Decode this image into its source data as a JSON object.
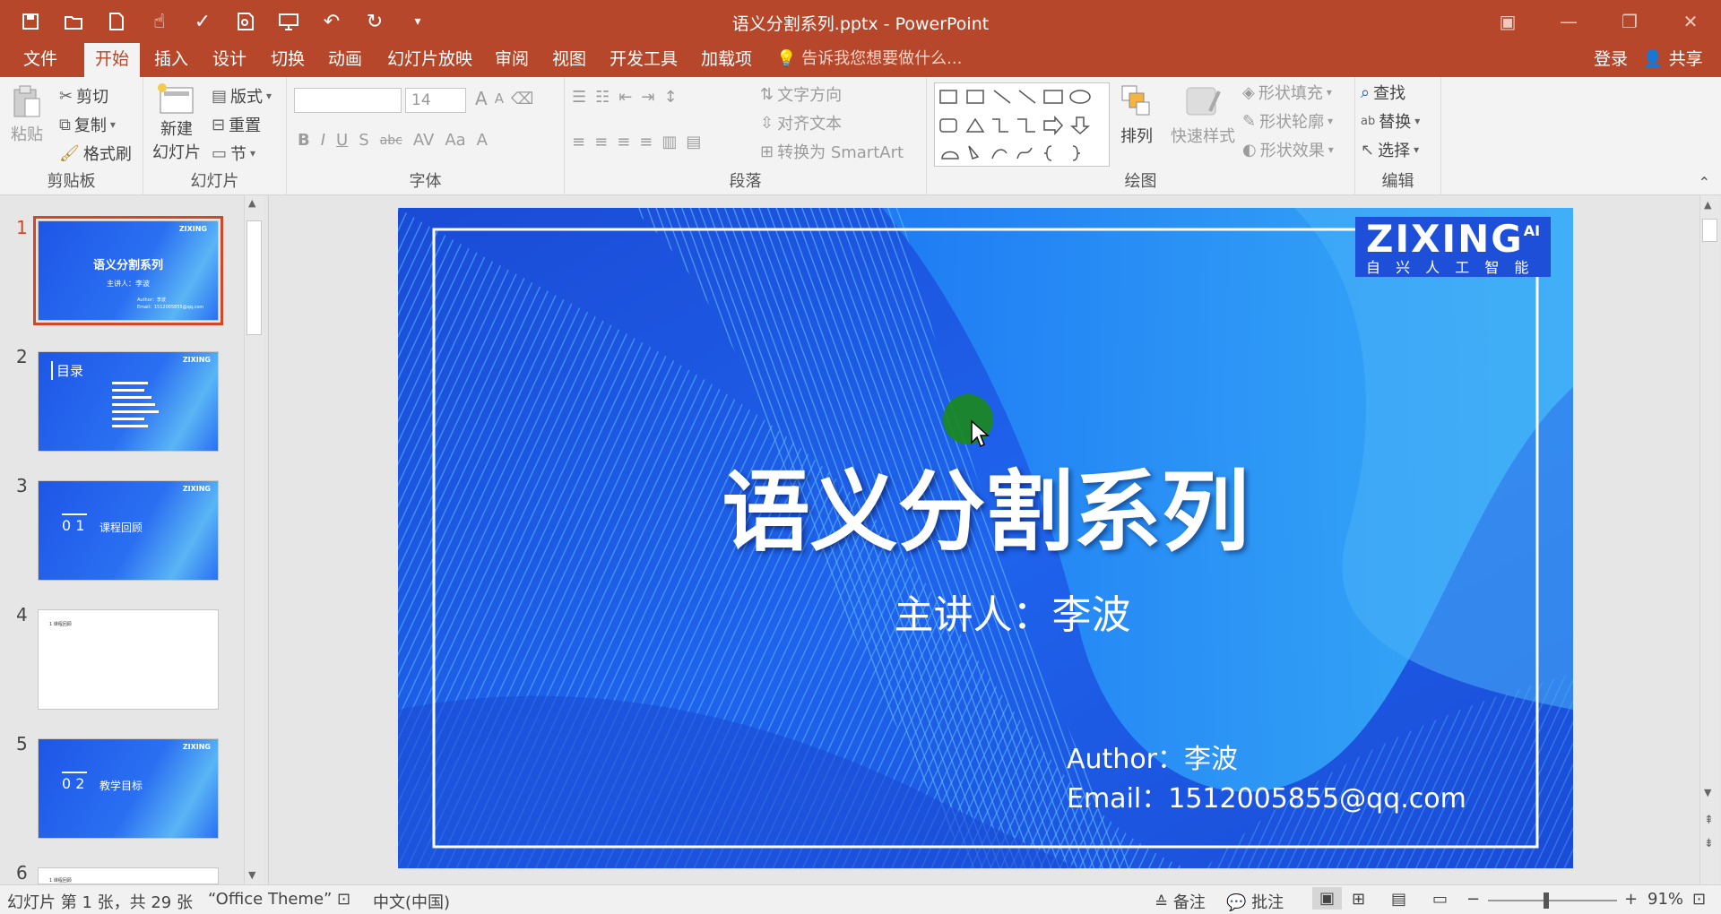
{
  "window": {
    "title": "语义分割系列.pptx - PowerPoint"
  },
  "qat": {
    "icons": [
      "save-icon",
      "open-icon",
      "new-icon",
      "touch-mode-icon",
      "spelling-icon",
      "print-preview-icon",
      "slideshow-icon",
      "undo-icon",
      "redo-icon",
      "customize-icon"
    ]
  },
  "tabs": [
    {
      "label": "文件"
    },
    {
      "label": "开始"
    },
    {
      "label": "插入"
    },
    {
      "label": "设计"
    },
    {
      "label": "切换"
    },
    {
      "label": "动画"
    },
    {
      "label": "幻灯片放映"
    },
    {
      "label": "审阅"
    },
    {
      "label": "视图"
    },
    {
      "label": "开发工具"
    },
    {
      "label": "加载项"
    }
  ],
  "tell_me": "告诉我您想要做什么...",
  "account": {
    "signin": "登录",
    "share": "共享"
  },
  "ribbon": {
    "clipboard": {
      "paste": "粘贴",
      "cut": "剪切",
      "copy": "复制",
      "format_painter": "格式刷",
      "label": "剪贴板"
    },
    "slides": {
      "new_slide_1": "新建",
      "new_slide_2": "幻灯片",
      "layout": "版式",
      "reset": "重置",
      "section": "节",
      "label": "幻灯片"
    },
    "font": {
      "size": "14",
      "label": "字体",
      "bold": "B",
      "italic": "I",
      "underline": "U",
      "shadow": "S",
      "strike": "abc",
      "spacing": "AV",
      "case": "Aa",
      "color": "A",
      "grow": "A",
      "shrink": "A"
    },
    "paragraph": {
      "text_direction": "文字方向",
      "align_text": "对齐文本",
      "smartart": "转换为 SmartArt",
      "label": "段落"
    },
    "drawing": {
      "arrange": "排列",
      "quick_styles": "快速样式",
      "fill": "形状填充",
      "outline": "形状轮廓",
      "effects": "形状效果",
      "label": "绘图"
    },
    "editing": {
      "find": "查找",
      "replace": "替换",
      "select": "选择",
      "label": "编辑"
    }
  },
  "thumbnails": [
    {
      "num": "1",
      "title": "语义分割系列",
      "sub": "主讲人：李波",
      "author": "Author：李波",
      "email": "Email：1512005855@qq.com",
      "logo": "ZIXING"
    },
    {
      "num": "2",
      "title": "目录",
      "logo": "ZIXING"
    },
    {
      "num": "3",
      "index": "0 1",
      "title": "课程回顾",
      "logo": "ZIXING"
    },
    {
      "num": "4",
      "title": "1 课程回顾"
    },
    {
      "num": "5",
      "index": "0 2",
      "title": "教学目标",
      "logo": "ZIXING"
    },
    {
      "num": "6",
      "title": "1 课程回顾"
    }
  ],
  "slide": {
    "logo": "ZIXING",
    "logo_sup": "AI",
    "logo_sub": "自 兴 人 工 智 能",
    "title": "语义分割系列",
    "subtitle": "主讲人：李波",
    "author_label": "Author：",
    "author": "李波",
    "email_label": "Email：",
    "email": "1512005855@qq.com"
  },
  "status": {
    "slide_info": "幻灯片 第 1 张，共 29 张",
    "theme": "“Office Theme”",
    "language": "中文(中国)",
    "notes": "备注",
    "comments": "批注",
    "zoom": "91%",
    "zoom_value": 0.91
  },
  "colors": {
    "accent": "#b7472a",
    "slide_bg": "#1d4fd8"
  }
}
